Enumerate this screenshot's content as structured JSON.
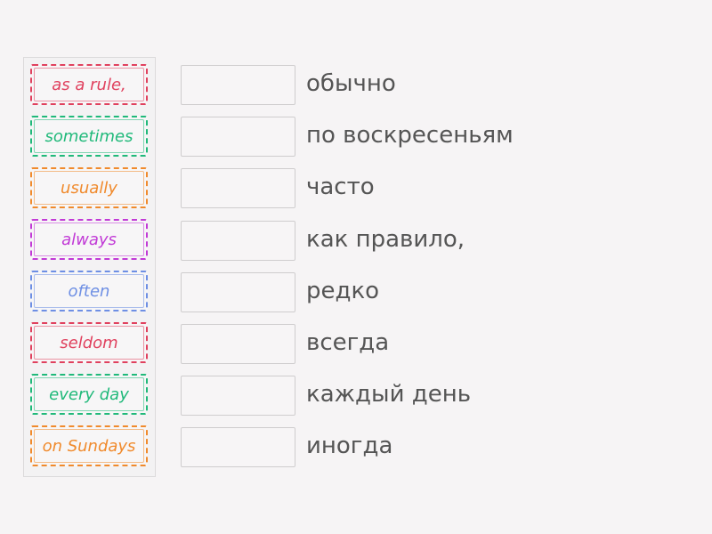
{
  "cards": [
    {
      "text": "as a rule,",
      "color": "#e0415e"
    },
    {
      "text": "sometimes",
      "color": "#20b97a"
    },
    {
      "text": "usually",
      "color": "#f08a2c"
    },
    {
      "text": "always",
      "color": "#c13ad6"
    },
    {
      "text": "often",
      "color": "#6e8fe4"
    },
    {
      "text": "seldom",
      "color": "#e0415e"
    },
    {
      "text": "every day",
      "color": "#20b97a"
    },
    {
      "text": "on Sundays",
      "color": "#f08a2c"
    }
  ],
  "targets": [
    {
      "label": "обычно"
    },
    {
      "label": "по воскресеньям"
    },
    {
      "label": "часто"
    },
    {
      "label": "как правило,"
    },
    {
      "label": "редко"
    },
    {
      "label": "всегда"
    },
    {
      "label": "каждый день"
    },
    {
      "label": "иногда"
    }
  ]
}
